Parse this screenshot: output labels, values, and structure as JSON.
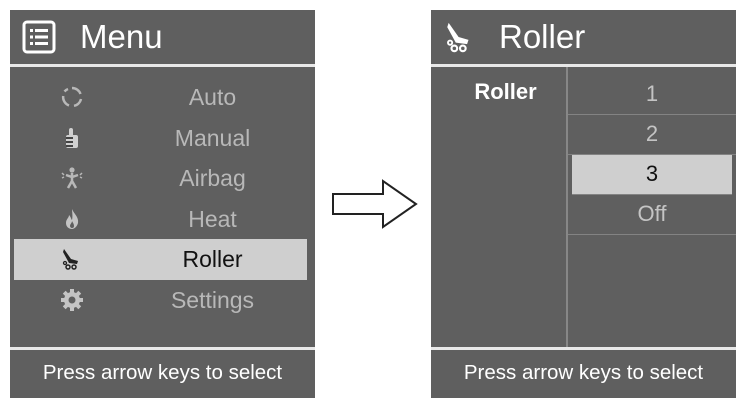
{
  "menu_screen": {
    "title": "Menu",
    "items": [
      {
        "label": "Auto",
        "icon": "cycle-icon",
        "selected": false
      },
      {
        "label": "Manual",
        "icon": "hand-icon",
        "selected": false
      },
      {
        "label": "Airbag",
        "icon": "airbag-body-icon",
        "selected": false
      },
      {
        "label": "Heat",
        "icon": "flame-icon",
        "selected": false
      },
      {
        "label": "Roller",
        "icon": "roller-icon",
        "selected": true
      },
      {
        "label": "Settings",
        "icon": "gear-icon",
        "selected": false
      }
    ],
    "footer": "Press arrow keys to select"
  },
  "roller_screen": {
    "title": "Roller",
    "side_label": "Roller",
    "options": [
      {
        "label": "1",
        "selected": false
      },
      {
        "label": "2",
        "selected": false
      },
      {
        "label": "3",
        "selected": true
      },
      {
        "label": "Off",
        "selected": false
      }
    ],
    "footer": "Press arrow keys to select"
  },
  "colors": {
    "panel": "#5f5f5f",
    "highlight": "#cfcfcf",
    "dim_text": "#b8b8b8",
    "text": "#ffffff"
  }
}
